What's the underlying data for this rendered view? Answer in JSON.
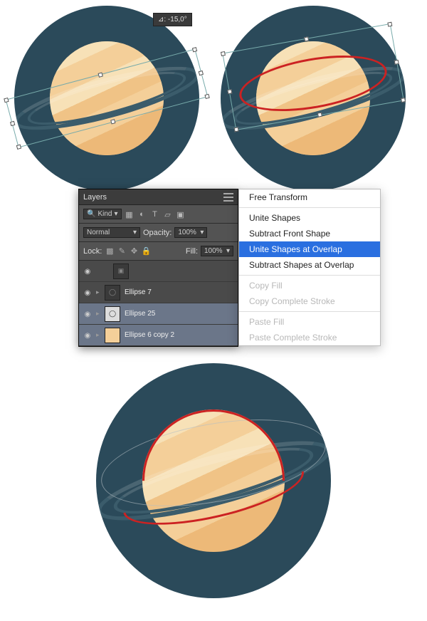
{
  "angle_tooltip": "⊿: -15,0°",
  "layers_panel": {
    "title": "Layers",
    "kind_label": "Kind",
    "blend_mode": "Normal",
    "opacity_label": "Opacity:",
    "opacity_value": "100%",
    "lock_label": "Lock:",
    "fill_label": "Fill:",
    "fill_value": "100%",
    "layers": [
      {
        "name": "",
        "selected": false,
        "visible": true
      },
      {
        "name": "Ellipse 7",
        "selected": false,
        "visible": true
      },
      {
        "name": "Ellipse 25",
        "selected": true,
        "visible": true
      },
      {
        "name": "Ellipse 6 copy 2",
        "selected": true,
        "visible": true
      }
    ]
  },
  "context_menu": {
    "items": [
      {
        "label": "Free Transform",
        "enabled": true
      },
      {
        "sep": true
      },
      {
        "label": "Unite Shapes",
        "enabled": true
      },
      {
        "label": "Subtract Front Shape",
        "enabled": true
      },
      {
        "label": "Unite Shapes at Overlap",
        "enabled": true,
        "highlight": true
      },
      {
        "label": "Subtract Shapes at Overlap",
        "enabled": true
      },
      {
        "sep": true
      },
      {
        "label": "Copy Fill",
        "enabled": false
      },
      {
        "label": "Copy Complete Stroke",
        "enabled": false
      },
      {
        "sep": true
      },
      {
        "label": "Paste Fill",
        "enabled": false
      },
      {
        "label": "Paste Complete Stroke",
        "enabled": false
      }
    ]
  }
}
